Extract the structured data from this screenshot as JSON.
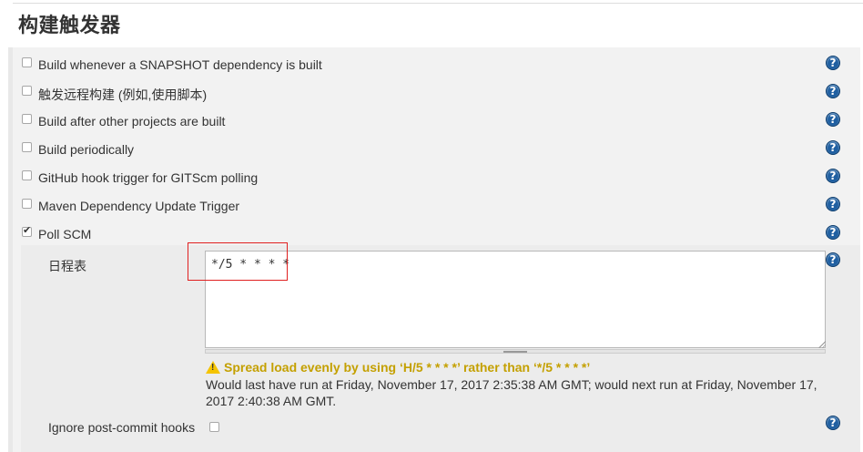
{
  "section": {
    "title": "构建触发器"
  },
  "triggers": [
    {
      "label": "Build whenever a SNAPSHOT dependency is built",
      "checked": false
    },
    {
      "label": "触发远程构建 (例如,使用脚本)",
      "checked": false
    },
    {
      "label": "Build after other projects are built",
      "checked": false
    },
    {
      "label": "Build periodically",
      "checked": false
    },
    {
      "label": "GitHub hook trigger for GITScm polling",
      "checked": false
    },
    {
      "label": "Maven Dependency Update Trigger",
      "checked": false
    },
    {
      "label": "Poll SCM",
      "checked": true
    }
  ],
  "poll_scm": {
    "schedule_label": "日程表",
    "schedule_value": "*/5 * * * *",
    "warning": "Spread load evenly by using ‘H/5 * * * *’ rather than ‘*/5 * * * *’",
    "info": "Would last have run at Friday, November 17, 2017 2:35:38 AM GMT; would next run at Friday, November 17, 2017 2:40:38 AM GMT.",
    "ignore_hooks_label": "Ignore post-commit hooks",
    "ignore_hooks_checked": false
  },
  "help_icon_glyph": "?",
  "colors": {
    "help_icon": "#1f5fa1",
    "warning_text": "#c4a000",
    "highlight_border": "#e02020"
  }
}
